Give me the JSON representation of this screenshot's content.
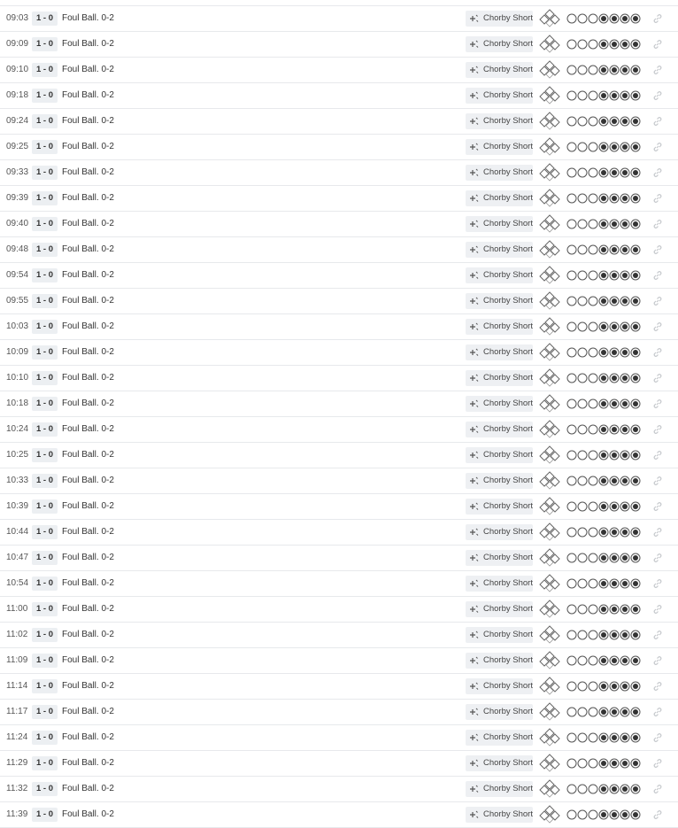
{
  "icons": {
    "player": "player-swap-icon",
    "bases": "bases-diamond-icon",
    "count": "count-circle-icon",
    "link": "link-icon"
  },
  "colors": {
    "row_border": "#e7e9ec",
    "badge_bg": "#eceff2",
    "filled_dot": "#333333"
  },
  "count_state": [
    "empty",
    "empty",
    "empty",
    "filled",
    "filled",
    "filled",
    "filled"
  ],
  "events": [
    {
      "time": "09:03",
      "score": "1 - 0",
      "desc": "Foul Ball. 0-2",
      "player": "Chorby Short"
    },
    {
      "time": "09:09",
      "score": "1 - 0",
      "desc": "Foul Ball. 0-2",
      "player": "Chorby Short"
    },
    {
      "time": "09:10",
      "score": "1 - 0",
      "desc": "Foul Ball. 0-2",
      "player": "Chorby Short"
    },
    {
      "time": "09:18",
      "score": "1 - 0",
      "desc": "Foul Ball. 0-2",
      "player": "Chorby Short"
    },
    {
      "time": "09:24",
      "score": "1 - 0",
      "desc": "Foul Ball. 0-2",
      "player": "Chorby Short"
    },
    {
      "time": "09:25",
      "score": "1 - 0",
      "desc": "Foul Ball. 0-2",
      "player": "Chorby Short"
    },
    {
      "time": "09:33",
      "score": "1 - 0",
      "desc": "Foul Ball. 0-2",
      "player": "Chorby Short"
    },
    {
      "time": "09:39",
      "score": "1 - 0",
      "desc": "Foul Ball. 0-2",
      "player": "Chorby Short"
    },
    {
      "time": "09:40",
      "score": "1 - 0",
      "desc": "Foul Ball. 0-2",
      "player": "Chorby Short"
    },
    {
      "time": "09:48",
      "score": "1 - 0",
      "desc": "Foul Ball. 0-2",
      "player": "Chorby Short"
    },
    {
      "time": "09:54",
      "score": "1 - 0",
      "desc": "Foul Ball. 0-2",
      "player": "Chorby Short"
    },
    {
      "time": "09:55",
      "score": "1 - 0",
      "desc": "Foul Ball. 0-2",
      "player": "Chorby Short"
    },
    {
      "time": "10:03",
      "score": "1 - 0",
      "desc": "Foul Ball. 0-2",
      "player": "Chorby Short"
    },
    {
      "time": "10:09",
      "score": "1 - 0",
      "desc": "Foul Ball. 0-2",
      "player": "Chorby Short"
    },
    {
      "time": "10:10",
      "score": "1 - 0",
      "desc": "Foul Ball. 0-2",
      "player": "Chorby Short"
    },
    {
      "time": "10:18",
      "score": "1 - 0",
      "desc": "Foul Ball. 0-2",
      "player": "Chorby Short"
    },
    {
      "time": "10:24",
      "score": "1 - 0",
      "desc": "Foul Ball. 0-2",
      "player": "Chorby Short"
    },
    {
      "time": "10:25",
      "score": "1 - 0",
      "desc": "Foul Ball. 0-2",
      "player": "Chorby Short"
    },
    {
      "time": "10:33",
      "score": "1 - 0",
      "desc": "Foul Ball. 0-2",
      "player": "Chorby Short"
    },
    {
      "time": "10:39",
      "score": "1 - 0",
      "desc": "Foul Ball. 0-2",
      "player": "Chorby Short"
    },
    {
      "time": "10:44",
      "score": "1 - 0",
      "desc": "Foul Ball. 0-2",
      "player": "Chorby Short"
    },
    {
      "time": "10:47",
      "score": "1 - 0",
      "desc": "Foul Ball. 0-2",
      "player": "Chorby Short"
    },
    {
      "time": "10:54",
      "score": "1 - 0",
      "desc": "Foul Ball. 0-2",
      "player": "Chorby Short"
    },
    {
      "time": "11:00",
      "score": "1 - 0",
      "desc": "Foul Ball. 0-2",
      "player": "Chorby Short"
    },
    {
      "time": "11:02",
      "score": "1 - 0",
      "desc": "Foul Ball. 0-2",
      "player": "Chorby Short"
    },
    {
      "time": "11:09",
      "score": "1 - 0",
      "desc": "Foul Ball. 0-2",
      "player": "Chorby Short"
    },
    {
      "time": "11:14",
      "score": "1 - 0",
      "desc": "Foul Ball. 0-2",
      "player": "Chorby Short"
    },
    {
      "time": "11:17",
      "score": "1 - 0",
      "desc": "Foul Ball. 0-2",
      "player": "Chorby Short"
    },
    {
      "time": "11:24",
      "score": "1 - 0",
      "desc": "Foul Ball. 0-2",
      "player": "Chorby Short"
    },
    {
      "time": "11:29",
      "score": "1 - 0",
      "desc": "Foul Ball. 0-2",
      "player": "Chorby Short"
    },
    {
      "time": "11:32",
      "score": "1 - 0",
      "desc": "Foul Ball. 0-2",
      "player": "Chorby Short"
    },
    {
      "time": "11:39",
      "score": "1 - 0",
      "desc": "Foul Ball. 0-2",
      "player": "Chorby Short"
    }
  ]
}
